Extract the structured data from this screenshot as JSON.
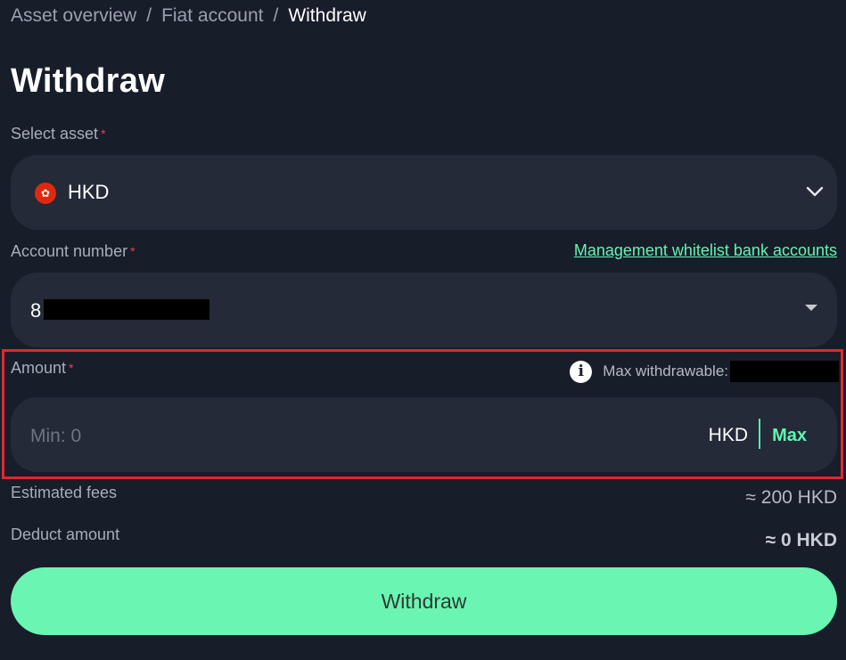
{
  "breadcrumb": {
    "items": [
      "Asset overview",
      "Fiat account"
    ],
    "separator": "/",
    "current": "Withdraw"
  },
  "page_title": "Withdraw",
  "select_asset": {
    "label": "Select asset",
    "required_mark": "*",
    "value": "HKD",
    "flag_icon": "hong-kong-flag-icon",
    "flag_glyph": "✿"
  },
  "account_number": {
    "label": "Account number",
    "required_mark": "*",
    "value": "8",
    "whitelist_link": "Management whitelist bank accounts"
  },
  "amount": {
    "label": "Amount",
    "required_mark": "*",
    "info_glyph": "i",
    "max_withdrawable_label": "Max withdrawable:",
    "placeholder": "Min: 0",
    "unit": "HKD",
    "max_button": "Max"
  },
  "estimated_fees": {
    "label": "Estimated fees",
    "value": "≈ 200 HKD"
  },
  "deduct_amount": {
    "label": "Deduct amount",
    "value": "≈ 0 HKD"
  },
  "submit_button": "Withdraw",
  "colors": {
    "background": "#181d2a",
    "field": "#242a38",
    "accent": "#63f5b0",
    "required": "#e5414b",
    "highlight": "#e0272e"
  }
}
